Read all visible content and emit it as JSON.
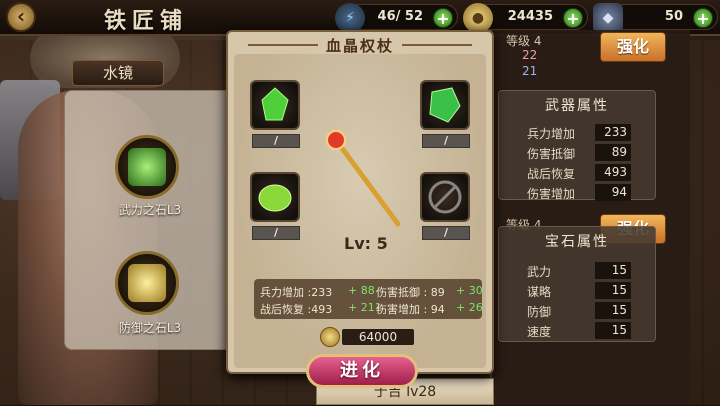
{
  "header": {
    "title": "铁匠铺",
    "back_icon": "back-arrow-icon",
    "resources": [
      {
        "icon": "lightning-icon",
        "value": "46/ 52"
      },
      {
        "icon": "coin-icon",
        "value": "24435"
      },
      {
        "icon": "badge-icon",
        "value": "50"
      }
    ]
  },
  "left": {
    "tab_label": "水镜",
    "gems": [
      {
        "label": "武力之石L3",
        "color": "#6bd24a"
      },
      {
        "label": "防御之石L3",
        "color": "#e2c45a"
      }
    ]
  },
  "right": {
    "level_label": "等级 4",
    "stat_a": "22",
    "stat_b": "21",
    "upgrade_label": "强化",
    "weapon_attr": {
      "title": "武器属性",
      "rows": [
        {
          "name": "兵力增加",
          "value": "233"
        },
        {
          "name": "伤害抵御",
          "value": "89"
        },
        {
          "name": "战后恢复",
          "value": "493"
        },
        {
          "name": "伤害增加",
          "value": "94"
        }
      ]
    },
    "level_label_2": "等级 4",
    "upgrade_label_2": "强化",
    "gem_attr": {
      "title": "宝石属性",
      "rows": [
        {
          "name": "武力",
          "value": "15"
        },
        {
          "name": "谋略",
          "value": "15"
        },
        {
          "name": "防御",
          "value": "15"
        },
        {
          "name": "速度",
          "value": "15"
        }
      ]
    },
    "bottom_name": "于吉   lv28"
  },
  "modal": {
    "title": "血晶权杖",
    "slots": [
      {
        "icon": "green-crystal-icon",
        "bar": "/"
      },
      {
        "icon": "green-gem-icon",
        "bar": "/"
      },
      {
        "icon": "green-blob-icon",
        "bar": "/"
      },
      {
        "icon": "locked-slot-icon",
        "bar": "/"
      }
    ],
    "level": "Lv: 5",
    "stats": {
      "s1": "兵力增加 :233",
      "s1_plus": "+ 88",
      "s2": "伤害抵御 : 89",
      "s2_plus": "+ 30",
      "s3": "战后恢复 :493",
      "s3_plus": "+ 211",
      "s4": "伤害增加 : 94",
      "s4_plus": "+ 26"
    },
    "cost": "64000",
    "evolve_label": "进化"
  }
}
